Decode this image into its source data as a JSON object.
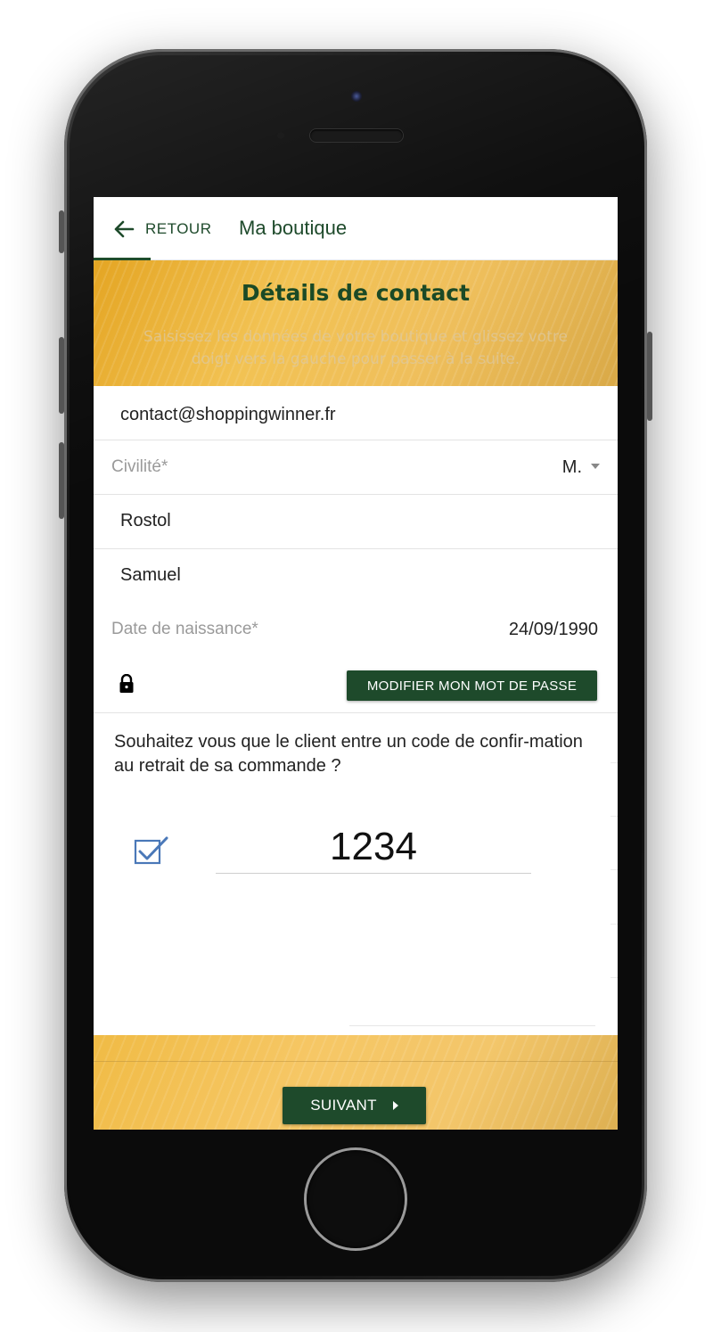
{
  "header": {
    "back_label": "RETOUR",
    "title": "Ma boutique"
  },
  "banner": {
    "title": "Détails de contact",
    "subtitle_line1": "Saisissez les données de votre boutique et glissez votre",
    "subtitle_line2": "doigt vers la gauche pour passer à la suite."
  },
  "form": {
    "email": "contact@shoppingwinner.fr",
    "civility_label": "Civilité*",
    "civility_value": "M.",
    "last_name": "Rostol",
    "first_name": "Samuel",
    "birthdate_label": "Date de naissance*",
    "birthdate_value": "24/09/1990",
    "password_button": "MODIFIER MON MOT DE PASSE",
    "question": "Souhaitez vous que le client entre un code de confir-mation au retrait de sa commande ?",
    "confirmation_enabled": true,
    "confirmation_code": "1234"
  },
  "footer": {
    "next_label": "SUIVANT"
  },
  "colors": {
    "primary": "#1e4a2b",
    "accent": "#f2c253",
    "checkbox": "#4a78b8"
  },
  "icons": [
    "arrow-left-icon",
    "chevron-down-icon",
    "lock-icon",
    "checkbox-checked-icon",
    "play-arrow-icon"
  ]
}
